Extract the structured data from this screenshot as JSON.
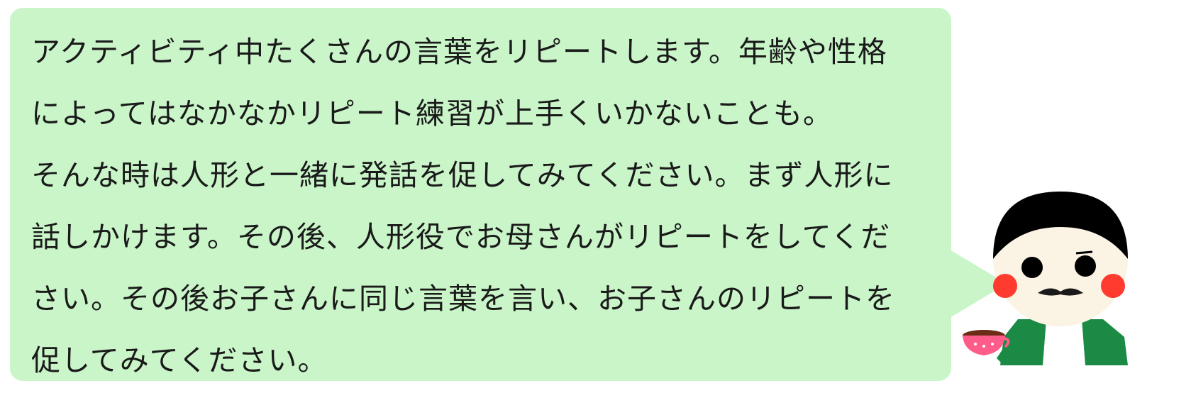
{
  "message": {
    "lines": [
      "アクティビティ中たくさんの言葉をリピートします。年齢や性格",
      "によってはなかなかリピート練習が上手くいかないことも。",
      "そんな時は人形と一緒に発話を促してみてください。まず人形に",
      "話しかけます。その後、人形役でお母さんがリピートをしてくだ",
      "さい。その後お子さんに同じ言葉を言い、お子さんのリピートを",
      "促してみてください。"
    ]
  },
  "colors": {
    "bubble": "#c9f5c9",
    "hair": "#000000",
    "face": "#fbf3e4",
    "cheek": "#ff3b2f",
    "shirt": "#1a8a44",
    "cup": "#ff5c8a"
  },
  "icons": {
    "character": "teacher-character-illustration",
    "cup": "teacup-icon"
  }
}
